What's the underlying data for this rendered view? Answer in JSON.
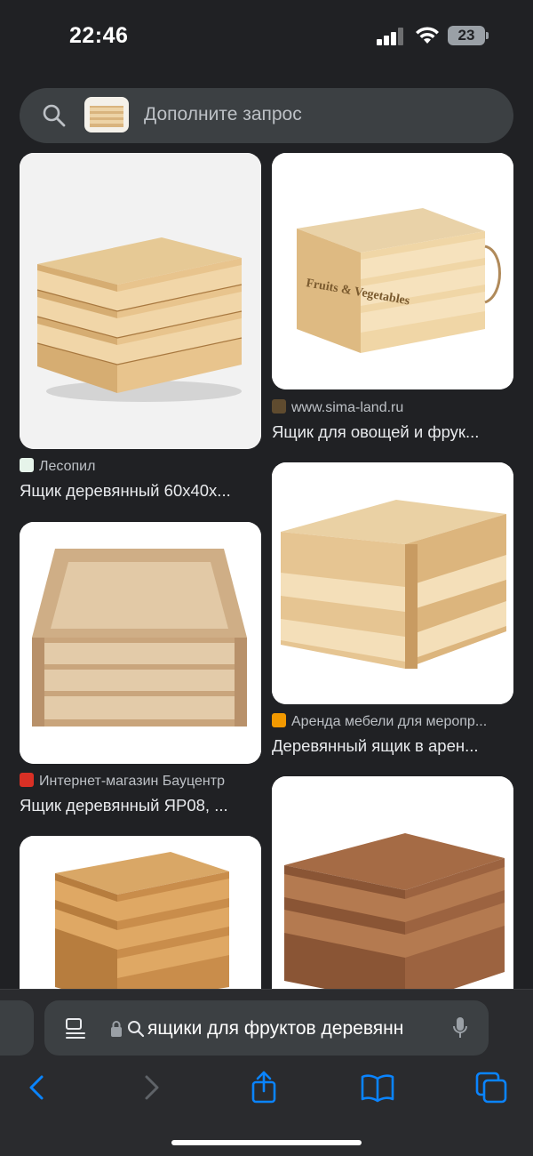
{
  "status_bar": {
    "time": "22:46",
    "battery": "23"
  },
  "search": {
    "placeholder": "Дополните запрос"
  },
  "results": [
    {
      "source": "Лесопил",
      "title": "Ящик деревянный 60х40х...",
      "favicon_color": "#e6f4ea"
    },
    {
      "source": "www.sima-land.ru",
      "title": "Ящик для овощей и фрук...",
      "favicon_color": "#5f4b2f",
      "image_text": "Fruits & Vegetables"
    },
    {
      "source": "Интернет-магазин Бауцентр",
      "title": "Ящик деревянный ЯР08, ...",
      "favicon_color": "#d93025"
    },
    {
      "source": "Аренда мебели для меропр...",
      "title": "Деревянный ящик в арен...",
      "favicon_color": "#f29900"
    },
    {
      "source": "",
      "title": ""
    },
    {
      "source": "",
      "title": ""
    }
  ],
  "toolbar": {
    "url": "ящики для фруктов деревянн"
  },
  "colors": {
    "accent": "#0a84ff",
    "background": "#202124",
    "wood_light": "#e3c28f",
    "wood_dark": "#b98a55",
    "wood_burnt": "#8a5a3a"
  }
}
